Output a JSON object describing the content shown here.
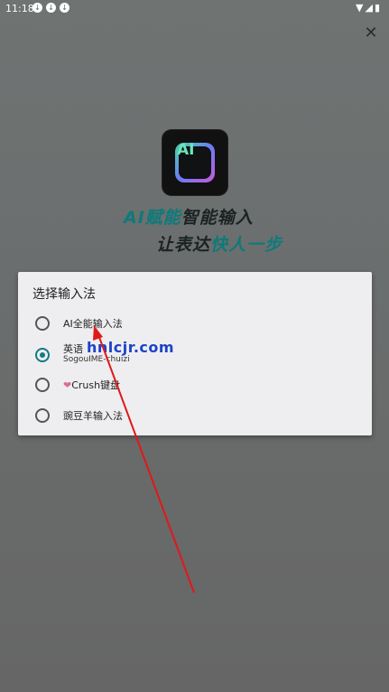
{
  "status_bar": {
    "time": "11:18",
    "download_icons": 3,
    "right_icons": "wifi-icon signal-icon battery-icon"
  },
  "close": {
    "icon": "close-icon",
    "glyph": "✕"
  },
  "logo": {
    "text": "AI",
    "icon": "keyboard-icon"
  },
  "tagline": {
    "line1_a": "AI赋能",
    "line1_b": "智能输入",
    "line2_a": "让表达",
    "line2_b": "快人一步"
  },
  "dialog": {
    "title": "选择输入法",
    "options": [
      {
        "label": "AI全能输入法",
        "sub": "",
        "checked": false
      },
      {
        "label": "英语",
        "sub": "SogouIME-chuizi",
        "checked": true
      },
      {
        "label": "Crush键盘",
        "sub": "",
        "checked": false,
        "prefix_icon": "heart-icon"
      },
      {
        "label": "豌豆羊输入法",
        "sub": "",
        "checked": false
      }
    ]
  },
  "watermark": "hnlcjr.com",
  "colors": {
    "accent": "#137a86",
    "watermark": "#1c43c8",
    "arrow": "#e01818"
  }
}
